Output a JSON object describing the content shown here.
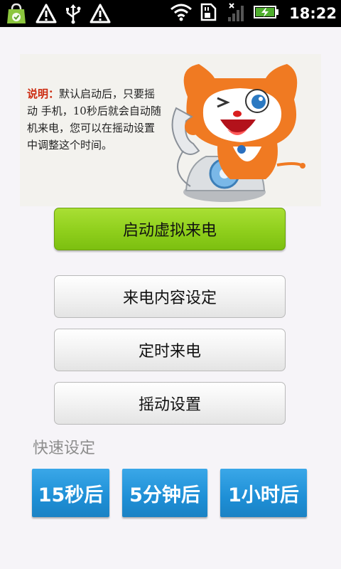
{
  "status_bar": {
    "time": "18:22",
    "icons": [
      "market-bag-icon",
      "warning-icon",
      "usb-icon",
      "warning-icon",
      "wifi-icon",
      "sd-card-icon",
      "no-signal-icon",
      "battery-charging-icon"
    ]
  },
  "banner": {
    "label": "说明：",
    "text": "默认启动后，只要摇动 手机，10秒后就会自动随机来电，您可以在摇动设置中调整这个时间。"
  },
  "buttons": {
    "start": "启动虚拟来电",
    "content_settings": "来电内容设定",
    "timed_call": "定时来电",
    "shake_settings": "摇动设置"
  },
  "quick": {
    "title": "快速设定",
    "options": [
      "15秒后",
      "5分钟后",
      "1小时后"
    ]
  },
  "colors": {
    "start_button": "#8fcf1c",
    "quick_button": "#1e8fd6",
    "label_red": "#cc2b10"
  }
}
